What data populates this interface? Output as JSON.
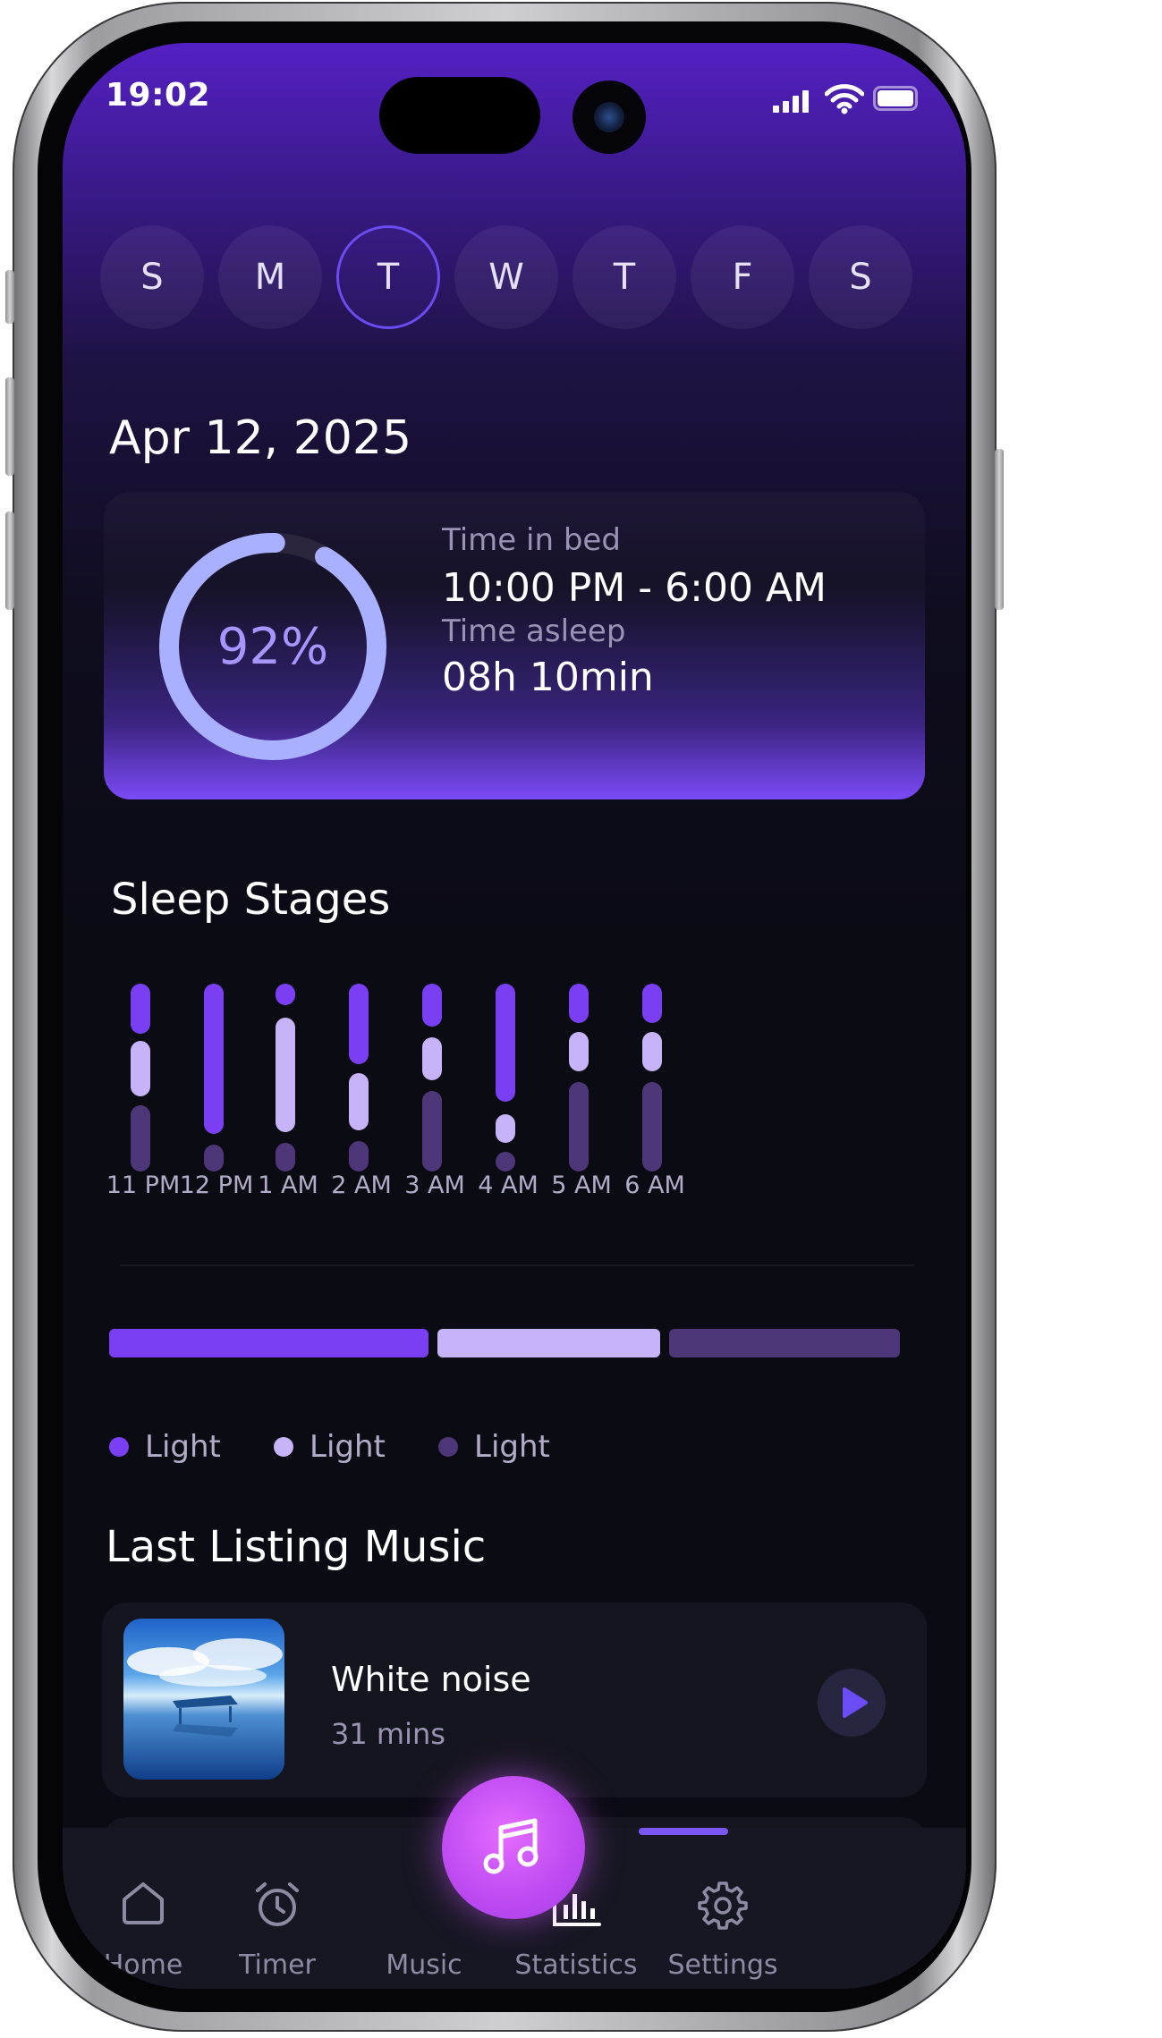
{
  "status": {
    "time": "19:02"
  },
  "days": [
    "S",
    "M",
    "T",
    "W",
    "T",
    "F",
    "S"
  ],
  "active_day_index": 2,
  "date": "Apr 12, 2025",
  "summary": {
    "score_label": "92%",
    "score": 0.92,
    "time_in_bed_label": "Time in bed",
    "time_in_bed": "10:00 PM - 6:00 AM",
    "time_asleep_label": "Time asleep",
    "time_asleep": "08h 10min"
  },
  "sleep_stages": {
    "title": "Sleep Stages",
    "hours": [
      "11 PM",
      "12 PM",
      "1 AM",
      "2 AM",
      "3 AM",
      "4 AM",
      "5 AM",
      "6 AM"
    ],
    "colors": {
      "deep": "#7a3ff2",
      "light": "#c7b3f7",
      "rem": "#4e3778"
    },
    "summary_bar": [
      {
        "color": "#7a3ff2",
        "share": 0.41
      },
      {
        "color": "#c7b3f7",
        "share": 0.29
      },
      {
        "color": "#4e3778",
        "share": 0.3
      }
    ],
    "legend": [
      {
        "label": "Light",
        "color": "#7a3ff2"
      },
      {
        "label": "Light",
        "color": "#c7b3f7"
      },
      {
        "label": "Light",
        "color": "#4e3778"
      }
    ]
  },
  "music": {
    "title": "Last Listing Music",
    "track": {
      "title": "White noise",
      "duration": "31 mins"
    }
  },
  "tabs": [
    {
      "label": "Home",
      "icon": "home-icon"
    },
    {
      "label": "Timer",
      "icon": "alarm-clock-icon"
    },
    {
      "label": "Music",
      "icon": "music-note-icon"
    },
    {
      "label": "Statistics",
      "icon": "bar-chart-icon"
    },
    {
      "label": "Settings",
      "icon": "gear-icon"
    }
  ],
  "active_tab": "Statistics"
}
